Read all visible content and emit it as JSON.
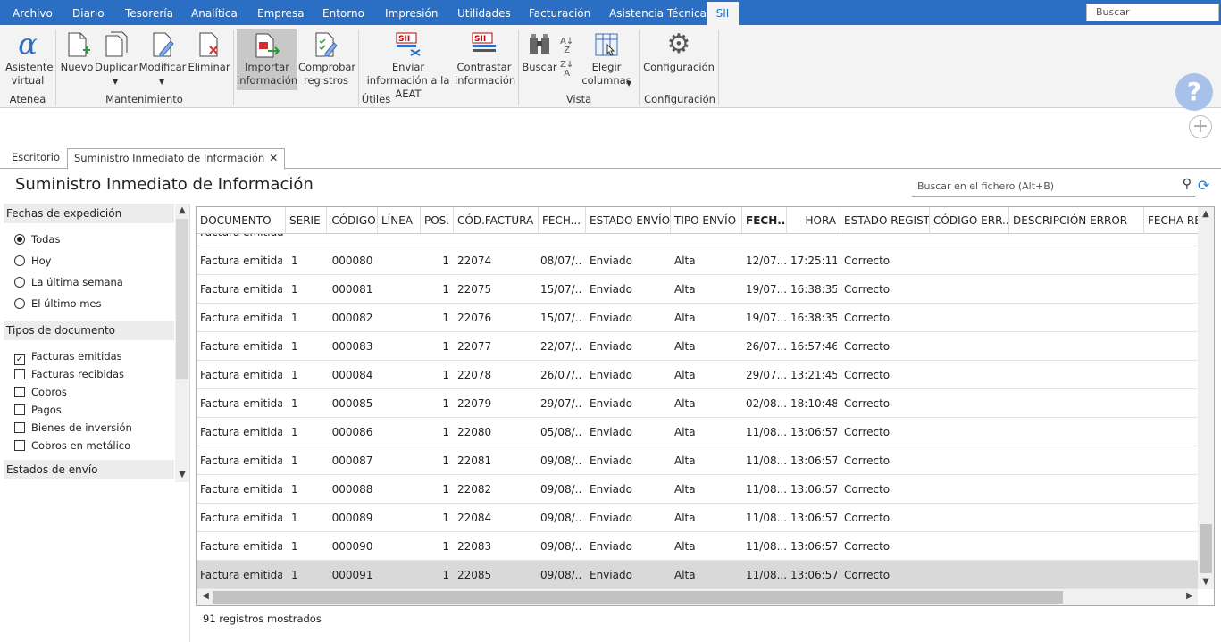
{
  "menu": {
    "items": [
      "Archivo",
      "Diario",
      "Tesorería",
      "Analítica",
      "Empresa",
      "Entorno",
      "Impresión",
      "Utilidades",
      "Facturación",
      "Asistencia Técnica",
      "SII"
    ],
    "search_placeholder": "Buscar"
  },
  "ribbon": {
    "asistente": "Asistente virtual",
    "nuevo": "Nuevo",
    "duplicar": "Duplicar",
    "modificar": "Modificar",
    "eliminar": "Eliminar",
    "importar": "Importar información",
    "comprobar": "Comprobar registros",
    "enviar": "Enviar información a la AEAT",
    "contrastar": "Contrastar información",
    "buscar": "Buscar",
    "elegir": "Elegir columnas",
    "configuracion": "Configuración",
    "groups": {
      "atenea": "Atenea",
      "mantenimiento": "Mantenimiento",
      "utiles": "Útiles",
      "vista": "Vista",
      "configuracion": "Configuración"
    }
  },
  "tabs": {
    "escritorio": "Escritorio",
    "sii": "Suministro Inmediato de Información"
  },
  "page": {
    "title": "Suministro Inmediato de Información",
    "search_placeholder": "Buscar en el fichero (Alt+B)",
    "status": "91 registros mostrados"
  },
  "filters": {
    "fechas_title": "Fechas de expedición",
    "fechas": [
      "Todas",
      "Hoy",
      "La última semana",
      "El último mes"
    ],
    "fechas_selected": "Todas",
    "tipos_title": "Tipos de documento",
    "tipos": [
      {
        "label": "Facturas emitidas",
        "checked": true
      },
      {
        "label": "Facturas recibidas",
        "checked": false
      },
      {
        "label": "Cobros",
        "checked": false
      },
      {
        "label": "Pagos",
        "checked": false
      },
      {
        "label": "Bienes de inversión",
        "checked": false
      },
      {
        "label": "Cobros en metálico",
        "checked": false
      }
    ],
    "estados_title": "Estados de envío"
  },
  "table": {
    "columns": [
      "DOCUMENTO",
      "SERIE",
      "CÓDIGO",
      "LÍNEA",
      "POS.",
      "CÓD.FACTURA",
      "FECH...",
      "ESTADO ENVÍO",
      "TIPO ENVÍO",
      "FECH...",
      "HORA",
      "ESTADO REGIST...",
      "CÓDIGO ERR...",
      "DESCRIPCIÓN ERROR",
      "FECHA REG"
    ],
    "rows": [
      [
        "Factura emitida",
        "1",
        "000080",
        "1",
        "22074",
        "08/07/...",
        "Enviado",
        "Alta",
        "12/07...",
        "17:25:11",
        "Correcto"
      ],
      [
        "Factura emitida",
        "1",
        "000081",
        "1",
        "22075",
        "15/07/...",
        "Enviado",
        "Alta",
        "19/07...",
        "16:38:35",
        "Correcto"
      ],
      [
        "Factura emitida",
        "1",
        "000082",
        "1",
        "22076",
        "15/07/...",
        "Enviado",
        "Alta",
        "19/07...",
        "16:38:35",
        "Correcto"
      ],
      [
        "Factura emitida",
        "1",
        "000083",
        "1",
        "22077",
        "22/07/...",
        "Enviado",
        "Alta",
        "26/07...",
        "16:57:46",
        "Correcto"
      ],
      [
        "Factura emitida",
        "1",
        "000084",
        "1",
        "22078",
        "26/07/...",
        "Enviado",
        "Alta",
        "29/07...",
        "13:21:45",
        "Correcto"
      ],
      [
        "Factura emitida",
        "1",
        "000085",
        "1",
        "22079",
        "29/07/...",
        "Enviado",
        "Alta",
        "02/08...",
        "18:10:48",
        "Correcto"
      ],
      [
        "Factura emitida",
        "1",
        "000086",
        "1",
        "22080",
        "05/08/...",
        "Enviado",
        "Alta",
        "11/08...",
        "13:06:57",
        "Correcto"
      ],
      [
        "Factura emitida",
        "1",
        "000087",
        "1",
        "22081",
        "09/08/...",
        "Enviado",
        "Alta",
        "11/08...",
        "13:06:57",
        "Correcto"
      ],
      [
        "Factura emitida",
        "1",
        "000088",
        "1",
        "22082",
        "09/08/...",
        "Enviado",
        "Alta",
        "11/08...",
        "13:06:57",
        "Correcto"
      ],
      [
        "Factura emitida",
        "1",
        "000089",
        "1",
        "22084",
        "09/08/...",
        "Enviado",
        "Alta",
        "11/08...",
        "13:06:57",
        "Correcto"
      ],
      [
        "Factura emitida",
        "1",
        "000090",
        "1",
        "22083",
        "09/08/...",
        "Enviado",
        "Alta",
        "11/08...",
        "13:06:57",
        "Correcto"
      ],
      [
        "Factura emitida",
        "1",
        "000091",
        "1",
        "22085",
        "09/08/...",
        "Enviado",
        "Alta",
        "11/08...",
        "13:06:57",
        "Correcto"
      ]
    ],
    "selected_row": 11
  }
}
